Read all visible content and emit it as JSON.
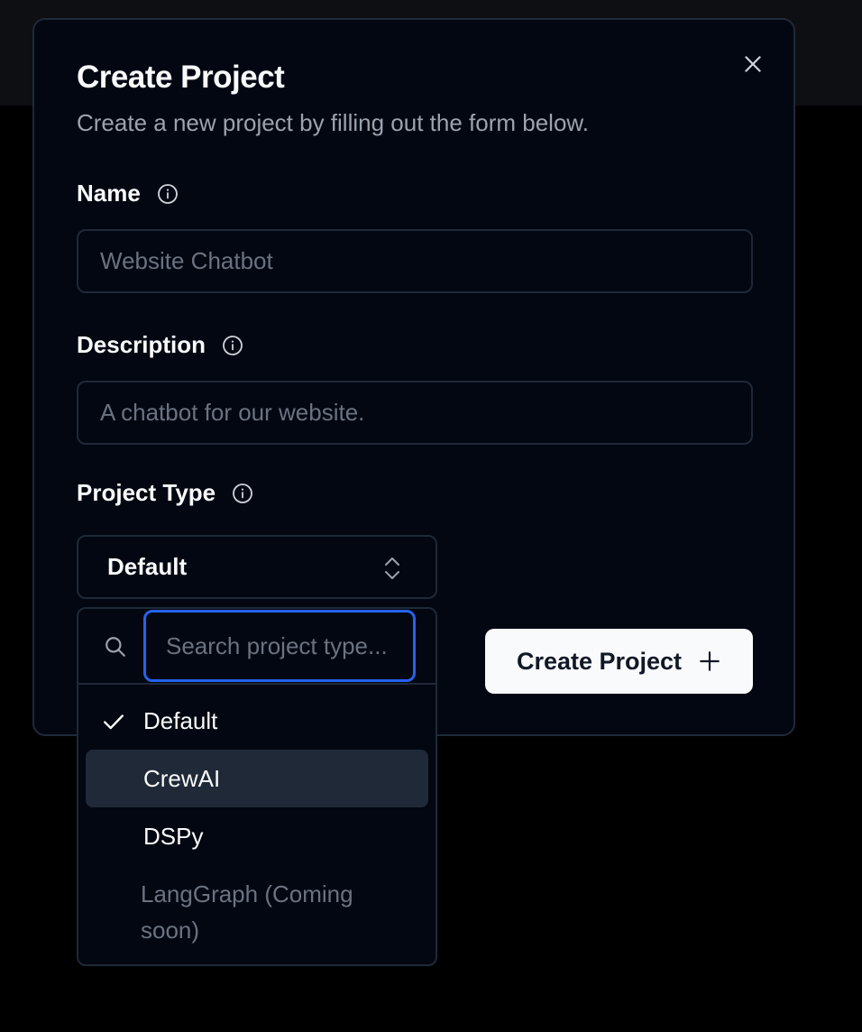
{
  "dialog": {
    "title": "Create Project",
    "subtitle": "Create a new project by filling out the form below.",
    "close_icon": "close-icon"
  },
  "form": {
    "name": {
      "label": "Name",
      "placeholder": "Website Chatbot"
    },
    "description": {
      "label": "Description",
      "placeholder": "A chatbot for our website."
    },
    "project_type": {
      "label": "Project Type",
      "selected": "Default"
    }
  },
  "dropdown": {
    "search_placeholder": "Search project type...",
    "options": [
      {
        "label": "Default",
        "checked": true
      },
      {
        "label": "CrewAI",
        "highlighted": true
      },
      {
        "label": "DSPy"
      },
      {
        "label": "LangGraph (Coming soon)",
        "disabled": true
      }
    ]
  },
  "actions": {
    "create_label": "Create Project"
  },
  "colors": {
    "background": "#000000",
    "dialog_bg": "#030712",
    "border": "#1f2937",
    "focus_ring": "#2563eb",
    "primary_text": "#f9fafb",
    "muted_text": "#9ca3af",
    "button_bg": "#f9fafb"
  }
}
